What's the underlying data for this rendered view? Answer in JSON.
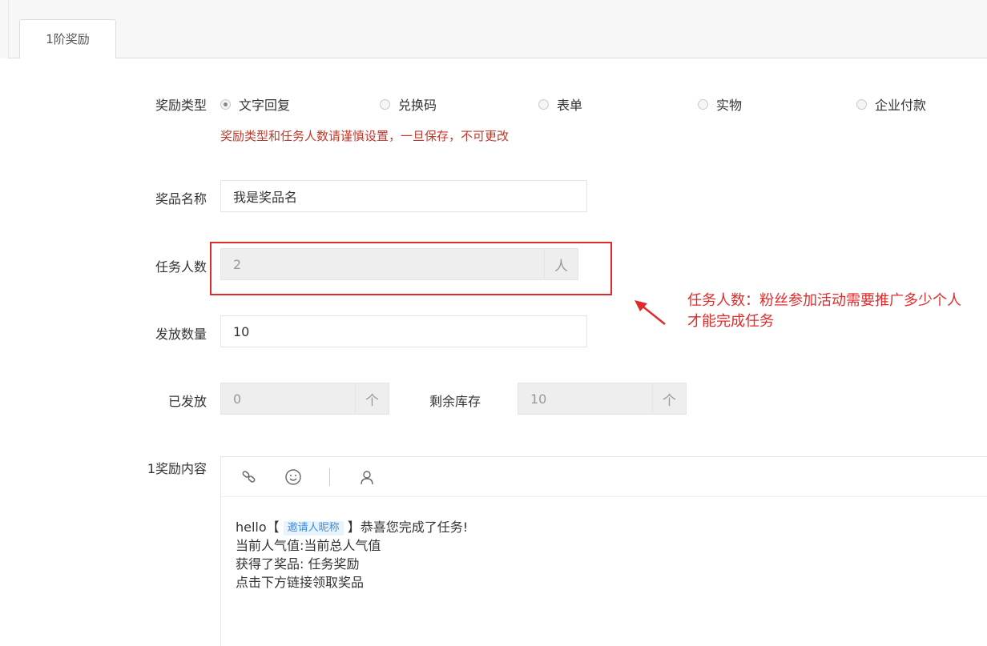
{
  "tabs": [
    {
      "label": "1阶奖励"
    }
  ],
  "reward_type": {
    "label": "奖励类型",
    "options": [
      {
        "label": "文字回复",
        "checked": true
      },
      {
        "label": "兑换码",
        "checked": false
      },
      {
        "label": "表单",
        "checked": false
      },
      {
        "label": "实物",
        "checked": false
      },
      {
        "label": "企业付款",
        "checked": false
      }
    ],
    "warning": "奖励类型和任务人数请谨慎设置，一旦保存，不可更改"
  },
  "prize_name": {
    "label": "奖品名称",
    "value": "我是奖品名"
  },
  "task_count": {
    "label": "任务人数",
    "value": "2",
    "unit": "人"
  },
  "issue_count": {
    "label": "发放数量",
    "value": "10"
  },
  "issued": {
    "label": "已发放",
    "value": "0",
    "unit": "个"
  },
  "remaining": {
    "label": "剩余库存",
    "value": "10",
    "unit": "个"
  },
  "annotation": {
    "line1": "任务人数：粉丝参加活动需要推广多少个人",
    "line2": "才能完成任务",
    "color": "#e02b2b"
  },
  "reward_content": {
    "label": "1奖励内容",
    "toolbar": [
      "link-icon",
      "emoji-icon",
      "user-icon"
    ],
    "lines": {
      "l1_prefix": "hello【",
      "l1_tag": "邀请人昵称",
      "l1_suffix": "】恭喜您完成了任务!",
      "l2": "当前人气值:当前总人气值",
      "l3": "获得了奖品: 任务奖励",
      "l4": "点击下方链接领取奖品"
    }
  }
}
